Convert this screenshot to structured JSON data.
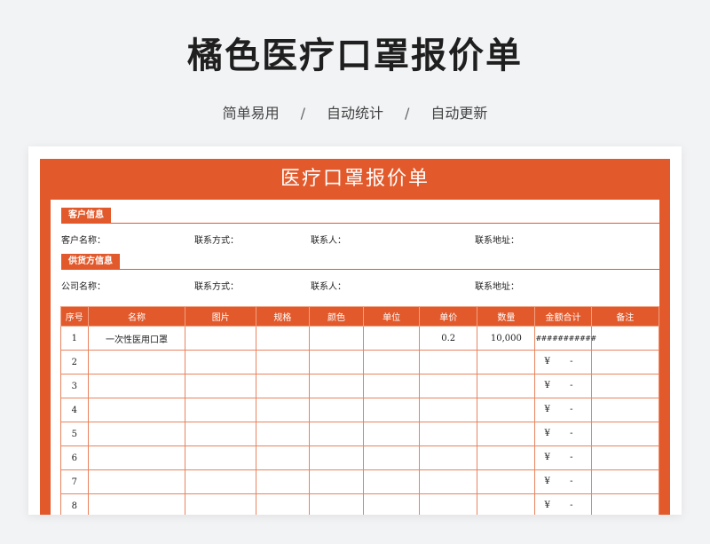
{
  "headline": "橘色医疗口罩报价单",
  "subtitle": {
    "items": [
      "简单易用",
      "自动统计",
      "自动更新"
    ],
    "separator": "/"
  },
  "sheet": {
    "title": "医疗口罩报价单",
    "customer": {
      "section": "客户信息",
      "fields": [
        "客户名称：",
        "联系方式：",
        "联系人：",
        "联系地址："
      ]
    },
    "supplier": {
      "section": "供货方信息",
      "fields": [
        "公司名称：",
        "联系方式：",
        "联系人：",
        "联系地址："
      ]
    },
    "table": {
      "headers": [
        "序号",
        "名称",
        "图片",
        "规格",
        "颜色",
        "单位",
        "单价",
        "数量",
        "金额合计",
        "备注"
      ],
      "rows": [
        {
          "no": "1",
          "name": "一次性医用口罩",
          "price": "0.2",
          "qty": "10,000",
          "amount": "###########"
        },
        {
          "no": "2",
          "yen": "¥",
          "dash": "-"
        },
        {
          "no": "3",
          "yen": "¥",
          "dash": "-"
        },
        {
          "no": "4",
          "yen": "¥",
          "dash": "-"
        },
        {
          "no": "5",
          "yen": "¥",
          "dash": "-"
        },
        {
          "no": "6",
          "yen": "¥",
          "dash": "-"
        },
        {
          "no": "7",
          "yen": "¥",
          "dash": "-"
        },
        {
          "no": "8",
          "yen": "¥",
          "dash": "-"
        }
      ]
    }
  },
  "colors": {
    "accent": "#e25a2c",
    "background": "#f2f3f5"
  }
}
